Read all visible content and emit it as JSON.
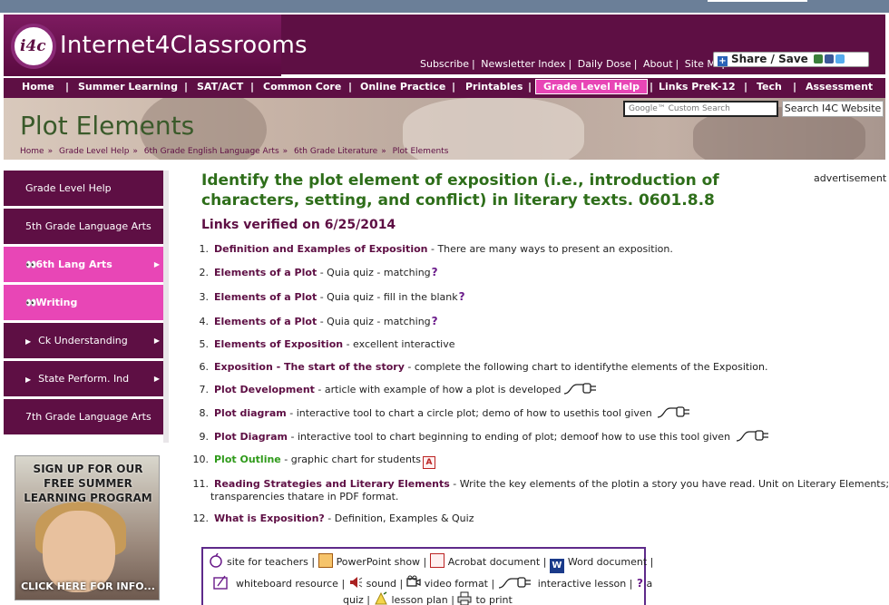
{
  "site": {
    "logo_mark": "i4c",
    "title": "Internet4Classrooms"
  },
  "toplinks": [
    "Subscribe",
    "Newsletter Index",
    "Daily Dose",
    "About",
    "Site Map"
  ],
  "share": {
    "label": "Share / Save"
  },
  "nav": {
    "items": [
      "Home",
      "Summer Learning",
      "SAT/ACT",
      "Common Core",
      "Online Practice",
      "Printables",
      "Grade Level Help",
      "Links PreK-12",
      "Tech",
      "Assessment"
    ],
    "active": "Grade Level Help"
  },
  "banner": {
    "title": "Plot Elements",
    "breadcrumb": [
      "Home",
      "Grade Level Help",
      "6th Grade English Language Arts",
      "6th Grade Literature",
      "Plot Elements"
    ]
  },
  "search": {
    "placeholder": "Google™ Custom Search",
    "button": "Search I4C Website"
  },
  "sidebar": {
    "items": [
      {
        "label": "Grade Level Help",
        "style": "dark"
      },
      {
        "label": "5th Grade Language Arts",
        "style": "dark"
      },
      {
        "label": "6th Lang Arts",
        "style": "pink"
      },
      {
        "label": "Writing",
        "style": "pink"
      },
      {
        "label": "Ck Understanding",
        "style": "dark"
      },
      {
        "label": "State Perform. Ind",
        "style": "dark"
      },
      {
        "label": "7th Grade Language Arts",
        "style": "dark"
      }
    ],
    "promo": {
      "lines": [
        "SIGN UP FOR OUR",
        "FREE SUMMER",
        "LEARNING PROGRAM"
      ],
      "cta": "CLICK HERE FOR INFO..."
    }
  },
  "advertisement": "advertisement",
  "main": {
    "heading": "Identify the plot element of exposition (i.e., introduction of characters, setting, and conflict) in literary texts. 0601.8.8",
    "verified": "Links verified on 6/25/2014",
    "links": [
      {
        "num": "1.",
        "title": "Definition and Examples of Exposition",
        "desc": " - There are many ways to present an exposition."
      },
      {
        "num": "2.",
        "title": "Elements of a Plot",
        "desc": " - Quia quiz - matching"
      },
      {
        "num": "3.",
        "title": "Elements of a Plot",
        "desc": " - Quia quiz - fill in the blank"
      },
      {
        "num": "4.",
        "title": "Elements of a Plot",
        "desc": " - Quia quiz - matching"
      },
      {
        "num": "5.",
        "title": "Elements of Exposition",
        "desc": " - excellent interactive"
      },
      {
        "num": "6.",
        "title": "Exposition - The start of the story",
        "desc": " - complete the following chart to identifythe elements of the Exposition."
      },
      {
        "num": "7.",
        "title": "Plot Development",
        "desc": " - article with example of how a plot is developed"
      },
      {
        "num": "8.",
        "title": "Plot diagram",
        "desc": " - interactive tool to chart a circle plot; demo of how to usethis tool given "
      },
      {
        "num": "9.",
        "title": "Plot Diagram",
        "desc": " - interactive tool to chart beginning to ending of plot; demoof how to use this tool given "
      },
      {
        "num": "10.",
        "title": "Plot Outline",
        "desc": " - graphic chart for students"
      },
      {
        "num": "11.",
        "title": "Reading Strategies and Literary Elements",
        "desc": " - Write the key elements of the plotin a story you have read. Unit on Literary Elements;",
        "desc2": "transparencies thatare in PDF format."
      },
      {
        "num": "12.",
        "title": "What is Exposition?",
        "desc": " - Definition, Examples & Quiz"
      }
    ]
  },
  "legend": {
    "site_for_teachers": "site for teachers",
    "powerpoint": "PowerPoint show",
    "acrobat": "Acrobat document",
    "word": "Word document",
    "whiteboard": "whiteboard resource",
    "sound": "sound",
    "video": "video format",
    "interactive": "interactive lesson",
    "quiz_a": "a",
    "quiz_b": "quiz",
    "lesson_plan": "lesson plan",
    "to_print": "to print"
  },
  "colors": {
    "brand": "#5e0f44",
    "accent_pink": "#e846b6",
    "heading_green": "#2e6e1a",
    "link_green": "#2f9a1a"
  }
}
